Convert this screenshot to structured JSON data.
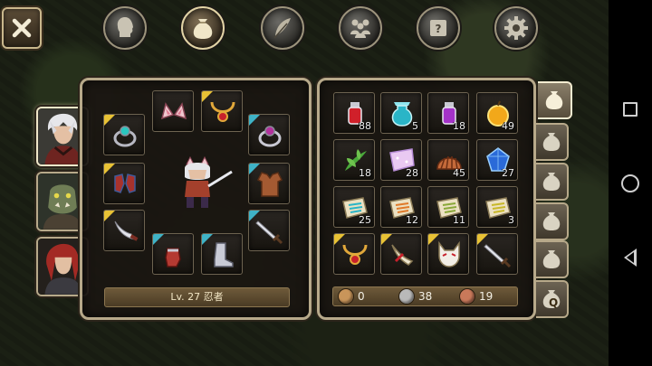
{
  "top_tabs": [
    {
      "name": "character",
      "icon": "head-silhouette-icon",
      "active": false
    },
    {
      "name": "inventory",
      "icon": "bag-icon",
      "active": true
    },
    {
      "name": "skills",
      "icon": "feather-icon",
      "active": false
    },
    {
      "name": "party",
      "icon": "people-icon",
      "active": false
    },
    {
      "name": "quests",
      "icon": "scroll-icon",
      "active": false
    },
    {
      "name": "settings",
      "icon": "gear-icon",
      "active": false
    }
  ],
  "characters": [
    {
      "portrait": "white-hair-ninja-portrait",
      "active": true
    },
    {
      "portrait": "orc-warrior-portrait",
      "active": false
    },
    {
      "portrait": "red-hair-swordsman-portrait",
      "active": false
    }
  ],
  "equipment": {
    "level_label": "Lv. 27 忍者",
    "slots": [
      {
        "item": "cat-ears-icon",
        "corner": null
      },
      {
        "item": "ruby-necklace-icon",
        "corner": "#e8c235"
      },
      {
        "item": "teal-ring-icon",
        "corner": "#e8c235"
      },
      {
        "item": "purple-ring-icon",
        "corner": "#3fb3c7"
      },
      {
        "item": "red-gauntlets-icon",
        "corner": "#e8c235"
      },
      {
        "item": "leather-vest-icon",
        "corner": "#3fb3c7"
      },
      {
        "item": "curved-dagger-icon",
        "corner": "#e8c235"
      },
      {
        "item": "sword-icon",
        "corner": "#3fb3c7"
      },
      {
        "item": "red-gloves-icon",
        "corner": "#3fb3c7"
      },
      {
        "item": "steel-boots-icon",
        "corner": "#3fb3c7"
      }
    ]
  },
  "inventory": {
    "items": [
      {
        "item": "red-potion-icon",
        "count": "88",
        "corner": null
      },
      {
        "item": "cyan-flask-icon",
        "count": "5",
        "corner": null
      },
      {
        "item": "purple-potion-icon",
        "count": "18",
        "corner": null
      },
      {
        "item": "golden-apple-icon",
        "count": "49",
        "corner": null
      },
      {
        "item": "green-herb-icon",
        "count": "18",
        "corner": null
      },
      {
        "item": "fairy-wing-icon",
        "count": "28",
        "corner": null
      },
      {
        "item": "shell-icon",
        "count": "45",
        "corner": null
      },
      {
        "item": "blue-gem-icon",
        "count": "27",
        "corner": null
      },
      {
        "item": "cyan-scroll-icon",
        "count": "25",
        "corner": null
      },
      {
        "item": "orange-scroll-icon",
        "count": "12",
        "corner": null
      },
      {
        "item": "green-scroll-icon",
        "count": "11",
        "corner": null
      },
      {
        "item": "yellow-scroll-icon",
        "count": "3",
        "corner": null
      },
      {
        "item": "ruby-necklace-icon",
        "count": "",
        "corner": "#e8c235"
      },
      {
        "item": "horn-charm-icon",
        "count": "",
        "corner": "#e8c235"
      },
      {
        "item": "fox-mask-icon",
        "count": "",
        "corner": "#e8c235"
      },
      {
        "item": "sword-icon",
        "count": "",
        "corner": "#e8c235"
      }
    ],
    "currency": [
      {
        "icon": "gold-coin-icon",
        "value": "0",
        "color": "#c9955a"
      },
      {
        "icon": "silver-coin-icon",
        "value": "38",
        "color": "#b9b9b9"
      },
      {
        "icon": "copper-coin-icon",
        "value": "19",
        "color": "#c9795a"
      }
    ]
  },
  "bag_tabs": [
    {
      "icon": "bag-icon",
      "active": true,
      "label": ""
    },
    {
      "icon": "bag-icon",
      "active": false,
      "label": ""
    },
    {
      "icon": "bag-icon",
      "active": false,
      "label": ""
    },
    {
      "icon": "bag-icon",
      "active": false,
      "label": ""
    },
    {
      "icon": "bag-icon",
      "active": false,
      "label": ""
    },
    {
      "icon": "bag-icon",
      "active": false,
      "label": "Q"
    }
  ]
}
